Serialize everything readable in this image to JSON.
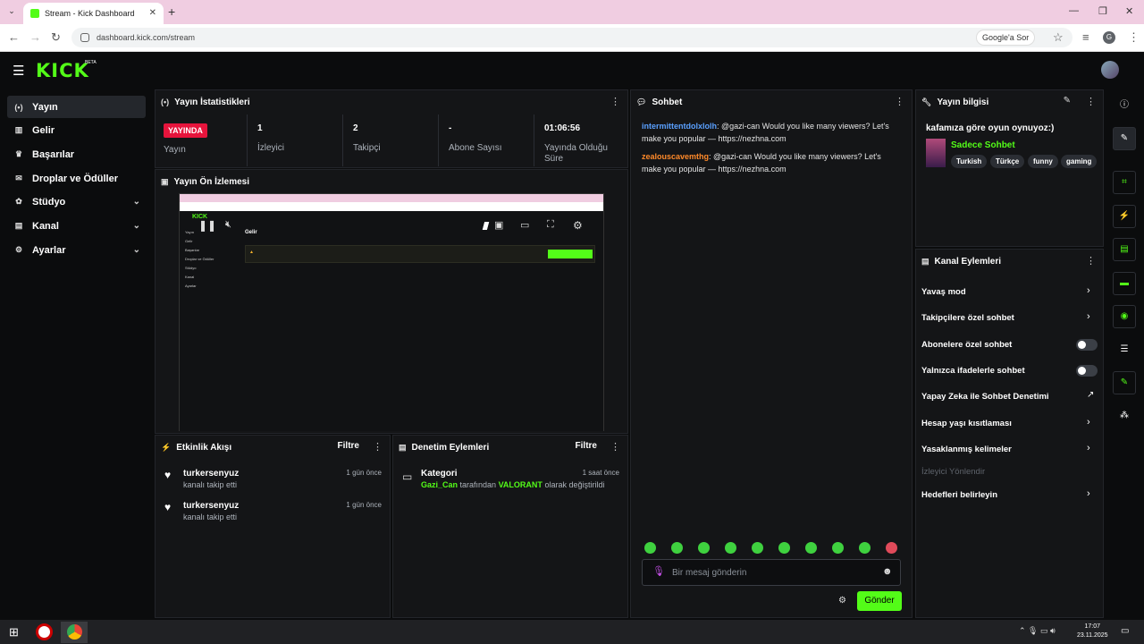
{
  "browser": {
    "tab_title": "Stream - Kick Dashboard",
    "url": "dashboard.kick.com/stream",
    "google_ask": "Google'a Sor",
    "profile_letter": "G"
  },
  "kick": {
    "logo": "KICK",
    "beta": "BETA"
  },
  "sidebar": {
    "items": [
      {
        "icon": "(•)",
        "label": "Yayın",
        "chevron": ""
      },
      {
        "icon": "▥",
        "label": "Gelir",
        "chevron": ""
      },
      {
        "icon": "♛",
        "label": "Başarılar",
        "chevron": ""
      },
      {
        "icon": "✉",
        "label": "Droplar ve Ödüller",
        "chevron": ""
      },
      {
        "icon": "✿",
        "label": "Stüdyo",
        "chevron": "⌄"
      },
      {
        "icon": "▤",
        "label": "Kanal",
        "chevron": "⌄"
      },
      {
        "icon": "⚙",
        "label": "Ayarlar",
        "chevron": "⌄"
      }
    ]
  },
  "stats": {
    "title": "Yayın İstatistikleri",
    "live_badge": "YAYINDA",
    "items": [
      {
        "value": "",
        "label": "Yayın"
      },
      {
        "value": "1",
        "label": "İzleyici"
      },
      {
        "value": "2",
        "label": "Takipçi"
      },
      {
        "value": "-",
        "label": "Abone Sayısı"
      },
      {
        "value": "01:06:56",
        "label": "Yayında Olduğu Süre"
      }
    ]
  },
  "preview": {
    "title": "Yayın Ön İzlemesi",
    "inner": {
      "logo": "KICK",
      "page_title": "Gelir",
      "nav": [
        "Yayın",
        "Gelir",
        "Başarılar",
        "Droplar ve Ödüller",
        "Stüdyo",
        "Kanal",
        "Ayarlar"
      ]
    }
  },
  "activity": {
    "title": "Etkinlik Akışı",
    "filter": "Filtre",
    "items": [
      {
        "user": "turkersenyuz",
        "action": "kanalı takip etti",
        "time": "1 gün önce"
      },
      {
        "user": "turkersenyuz",
        "action": "kanalı takip etti",
        "time": "1 gün önce"
      }
    ]
  },
  "moderation": {
    "title": "Denetim Eylemleri",
    "filter": "Filtre",
    "item": {
      "title": "Kategori",
      "user": "Gazi_Can",
      "middle": "tarafından",
      "value": "VALORANT",
      "tail": "olarak değiştirildi",
      "time": "1 saat önce"
    }
  },
  "chat": {
    "title": "Sohbet",
    "messages": [
      {
        "user": "intermittentdolxlolh",
        "text": ": @gazi-can Would you like many viewers? Let's make you popular — https://nezhna.com"
      },
      {
        "user": "zealouscavemthg",
        "text": ": @gazi-can Would you like many viewers? Let's make you popular — https://nezhna.com"
      }
    ],
    "placeholder": "Bir mesaj gönderin",
    "send": "Gönder"
  },
  "stream_info": {
    "title": "Yayın bilgisi",
    "stream_title": "kafamıza göre oyun oynuyoz:)",
    "category": "Sadece Sohbet",
    "tags": [
      "Turkish",
      "Türkçe",
      "funny",
      "gaming"
    ]
  },
  "channel_actions": {
    "title": "Kanal Eylemleri",
    "items": [
      {
        "label": "Yavaş mod",
        "control": "chevron"
      },
      {
        "label": "Takipçilere özel sohbet",
        "control": "chevron"
      },
      {
        "label": "Abonelere özel sohbet",
        "control": "toggle"
      },
      {
        "label": "Yalnızca ifadelerle sohbet",
        "control": "toggle"
      },
      {
        "label": "Yapay Zeka ile Sohbet Denetimi",
        "control": "external"
      },
      {
        "label": "Hesap yaşı kısıtlaması",
        "control": "chevron"
      },
      {
        "label": "Yasaklanmış kelimeler",
        "control": "chevron"
      },
      {
        "label": "İzleyici Yönlendir",
        "control": "disabled"
      },
      {
        "label": "Hedefleri belirleyin",
        "control": "chevron"
      }
    ]
  },
  "taskbar": {
    "time": "17:07",
    "date": "23.11.2025"
  },
  "colors": {
    "accent": "#53fc18",
    "live": "#e6143c",
    "panel": "#141517"
  }
}
